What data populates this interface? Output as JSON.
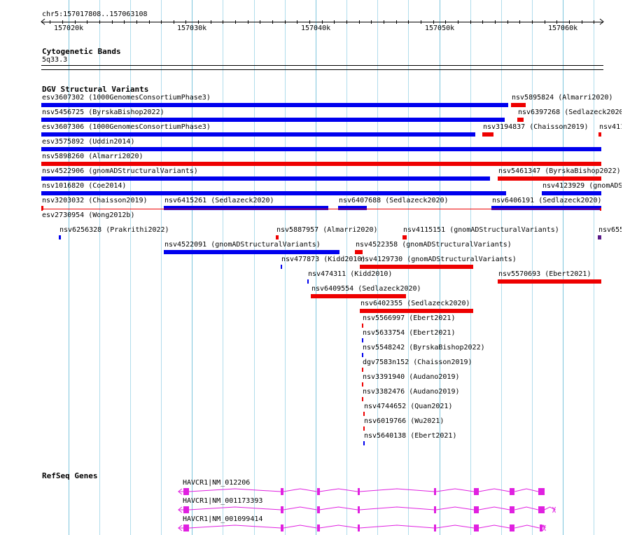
{
  "ruler": {
    "location": "chr5:157017808..157063108",
    "ticks": [
      "157020k",
      "157030k",
      "157040k",
      "157050k",
      "157060k"
    ]
  },
  "colors": {
    "loss": "#ee0000",
    "gain": "#0000ee",
    "gain_loss": "#5a1a8a",
    "complex": "#555555",
    "gene": "#e020e0",
    "gridline": "#b0dcec"
  },
  "tracks": {
    "cytoband": {
      "title": "Cytogenetic Bands",
      "band": "5q33.3"
    },
    "dgv": {
      "title": "DGV Structural Variants",
      "features": [
        {
          "id": "esv3607302",
          "study": "1000GenomesConsortiumPhase3",
          "start": 157017808,
          "end": 157055600,
          "type": "gain",
          "row": 0
        },
        {
          "id": "nsv5895824",
          "study": "Almarri2020",
          "start": 157055800,
          "end": 157057000,
          "type": "loss",
          "row": 0
        },
        {
          "id": "nsv5456725",
          "study": "ByrskaBishop2022",
          "start": 157017808,
          "end": 157055300,
          "type": "gain",
          "row": 1
        },
        {
          "id": "nsv6397268",
          "study": "Sedlazeck2020",
          "start": 157056300,
          "end": 157056800,
          "type": "loss",
          "row": 1
        },
        {
          "id": "esv3607306",
          "study": "1000GenomesConsortiumPhase3",
          "start": 157017808,
          "end": 157052900,
          "type": "gain",
          "row": 2
        },
        {
          "id": "nsv3194837",
          "study": "Chaisson2019",
          "start": 157053500,
          "end": 157054400,
          "type": "loss",
          "row": 2
        },
        {
          "id": "nsv411",
          "study": "",
          "start": 157062900,
          "end": 157063108,
          "type": "loss",
          "row": 2
        },
        {
          "id": "esv3575892",
          "study": "Uddin2014",
          "start": 157017808,
          "end": 157063108,
          "type": "gain",
          "row": 3
        },
        {
          "id": "nsv5898260",
          "study": "Almarri2020",
          "start": 157017808,
          "end": 157063108,
          "type": "loss",
          "row": 4
        },
        {
          "id": "nsv4522906",
          "study": "gnomADStructuralVariants",
          "start": 157017808,
          "end": 157054100,
          "type": "gain",
          "row": 5
        },
        {
          "id": "nsv5461347",
          "study": "ByrskaBishop2022",
          "start": 157054700,
          "end": 157063108,
          "type": "loss",
          "row": 5
        },
        {
          "id": "nsv1016820",
          "study": "Coe2014",
          "start": 157017808,
          "end": 157055400,
          "type": "gain",
          "row": 6
        },
        {
          "id": "nsv4123929",
          "study": "gnomADS",
          "start": 157058300,
          "end": 157063108,
          "type": "gain",
          "row": 6
        },
        {
          "id": "nsv3203032",
          "study": "Chaisson2019",
          "start": 157017808,
          "end": 157017960,
          "type": "loss",
          "row": 7
        },
        {
          "id": "nsv6415261",
          "study": "Sedlazeck2020",
          "start": 157027700,
          "end": 157041000,
          "type": "gain",
          "row": 7
        },
        {
          "id": "nsv6407688",
          "study": "Sedlazeck2020",
          "start": 157041800,
          "end": 157044100,
          "type": "gain",
          "row": 7
        },
        {
          "id": "nsv6406191",
          "study": "Sedlazeck2020",
          "start": 157054200,
          "end": 157063108,
          "type": "gain",
          "row": 7
        },
        {
          "id": "esv2730954",
          "study": "Wong2012b",
          "start": 157017808,
          "end": 157063108,
          "type": "loss",
          "row": 8,
          "thin": true
        },
        {
          "id": "nsv6256328",
          "study": "Prakrithi2022",
          "start": 157019250,
          "end": 157019400,
          "type": "gain",
          "row": 9
        },
        {
          "id": "nsv5887957",
          "study": "Almarri2020",
          "start": 157036800,
          "end": 157037050,
          "type": "loss",
          "row": 9
        },
        {
          "id": "nsv4115151",
          "study": "gnomADStructuralVariants",
          "start": 157047000,
          "end": 157047350,
          "type": "loss",
          "row": 9
        },
        {
          "id": "nsv655",
          "study": "",
          "start": 157062850,
          "end": 157063108,
          "type": "gain_loss",
          "row": 9
        },
        {
          "id": "nsv4522091",
          "study": "gnomADStructuralVariants",
          "start": 157027700,
          "end": 157041900,
          "type": "gain",
          "row": 10
        },
        {
          "id": "nsv4522358",
          "study": "gnomADStructuralVariants",
          "start": 157043200,
          "end": 157043850,
          "type": "loss",
          "row": 10
        },
        {
          "id": "nsv477873",
          "study": "Kidd2010",
          "start": 157037200,
          "end": 157037320,
          "type": "gain",
          "row": 11
        },
        {
          "id": "nsv4129730",
          "study": "gnomADStructuralVariants",
          "start": 157043600,
          "end": 157052800,
          "type": "loss",
          "row": 11
        },
        {
          "id": "nsv474311",
          "study": "Kidd2010",
          "start": 157039300,
          "end": 157039420,
          "type": "gain",
          "row": 12
        },
        {
          "id": "nsv5570693",
          "study": "Ebert2021",
          "start": 157054700,
          "end": 157063108,
          "type": "loss",
          "row": 12
        },
        {
          "id": "nsv6409554",
          "study": "Sedlazeck2020",
          "start": 157039600,
          "end": 157047300,
          "type": "loss",
          "row": 13
        },
        {
          "id": "nsv6402355",
          "study": "Sedlazeck2020",
          "start": 157043600,
          "end": 157052800,
          "type": "loss",
          "row": 14
        },
        {
          "id": "nsv5566997",
          "study": "Ebert2021",
          "start": 157043750,
          "end": 157043850,
          "type": "loss",
          "row": 15
        },
        {
          "id": "nsv5633754",
          "study": "Ebert2021",
          "start": 157043750,
          "end": 157043850,
          "type": "gain",
          "row": 16
        },
        {
          "id": "nsv5548242",
          "study": "ByrskaBishop2022",
          "start": 157043750,
          "end": 157043850,
          "type": "gain",
          "row": 17
        },
        {
          "id": "dgv7583n152",
          "study": "Chaisson2019",
          "start": 157043750,
          "end": 157043850,
          "type": "loss",
          "row": 18
        },
        {
          "id": "nsv3391940",
          "study": "Audano2019",
          "start": 157043750,
          "end": 157043850,
          "type": "loss",
          "row": 19
        },
        {
          "id": "nsv3382476",
          "study": "Audano2019",
          "start": 157043750,
          "end": 157043850,
          "type": "loss",
          "row": 20
        },
        {
          "id": "nsv4744652",
          "study": "Quan2021",
          "start": 157043850,
          "end": 157043950,
          "type": "loss",
          "row": 21
        },
        {
          "id": "nsv6019766",
          "study": "Wu2021",
          "start": 157043850,
          "end": 157043950,
          "type": "loss",
          "row": 22
        },
        {
          "id": "nsv5640138",
          "study": "Ebert2021",
          "start": 157043850,
          "end": 157043950,
          "type": "gain",
          "row": 23
        }
      ]
    },
    "refseq": {
      "title": "RefSeq Genes",
      "genes": [
        {
          "name": "HAVCR1|NM_012206",
          "start": 157028900,
          "end": 157058400,
          "exons": [
            [
              157029300,
              157029750
            ],
            [
              157037200,
              157037400
            ],
            [
              157040100,
              157040300
            ],
            [
              157043400,
              157043550
            ],
            [
              157049600,
              157049750
            ],
            [
              157052800,
              157053200
            ],
            [
              157055700,
              157056100
            ],
            [
              157058000,
              157058500
            ]
          ]
        },
        {
          "name": "HAVCR1|NM_001173393",
          "start": 157028900,
          "end": 157059400,
          "exons": [
            [
              157029300,
              157029750
            ],
            [
              157037200,
              157037400
            ],
            [
              157040100,
              157040300
            ],
            [
              157043400,
              157043550
            ],
            [
              157049600,
              157049750
            ],
            [
              157052800,
              157053200
            ],
            [
              157055700,
              157056100
            ],
            [
              157058000,
              157058500
            ]
          ]
        },
        {
          "name": "HAVCR1|NM_001099414",
          "start": 157028900,
          "end": 157058600,
          "exons": [
            [
              157029300,
              157029750
            ],
            [
              157037200,
              157037400
            ],
            [
              157040100,
              157040300
            ],
            [
              157043400,
              157043550
            ],
            [
              157049600,
              157049750
            ],
            [
              157052800,
              157053200
            ],
            [
              157055700,
              157056100
            ],
            [
              157058100,
              157058300
            ]
          ]
        }
      ]
    }
  }
}
